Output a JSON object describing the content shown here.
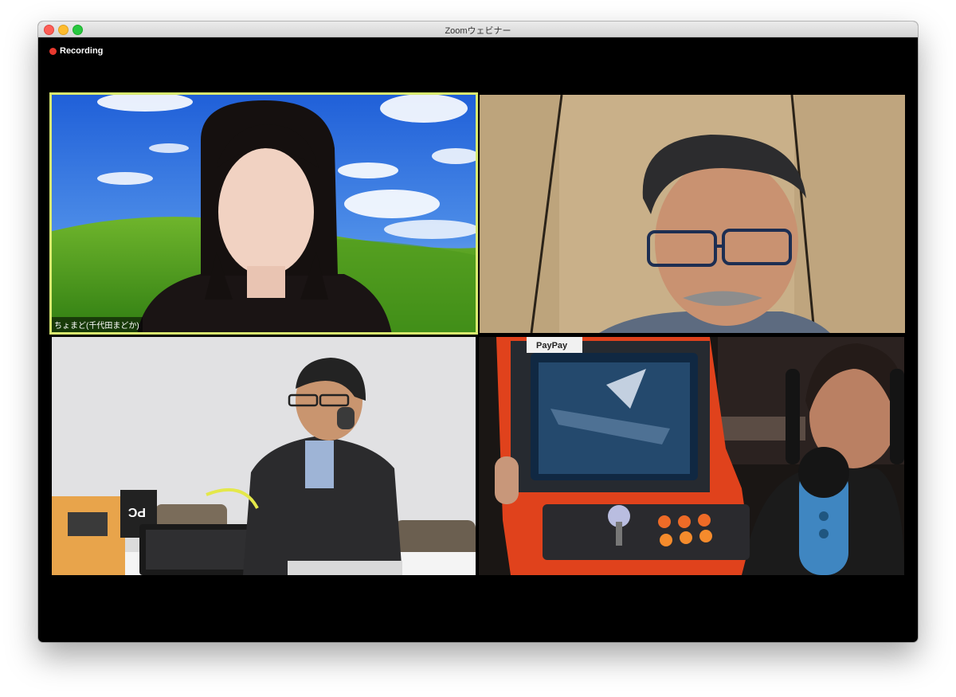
{
  "window": {
    "title": "Zoomウェビナー"
  },
  "status": {
    "recording_label": "Recording",
    "recording_color": "#e8392f"
  },
  "participants": [
    {
      "name_label": "ちょまど(千代田まどか)",
      "active_speaker": true,
      "active_color": "#d9ea6f"
    },
    {
      "name_label": "",
      "active_speaker": false
    },
    {
      "name_label": "",
      "active_speaker": false
    },
    {
      "name_label": "",
      "active_speaker": false
    }
  ],
  "scene_text": {
    "paypay_sign": "PayPay",
    "box_label": "PC"
  }
}
